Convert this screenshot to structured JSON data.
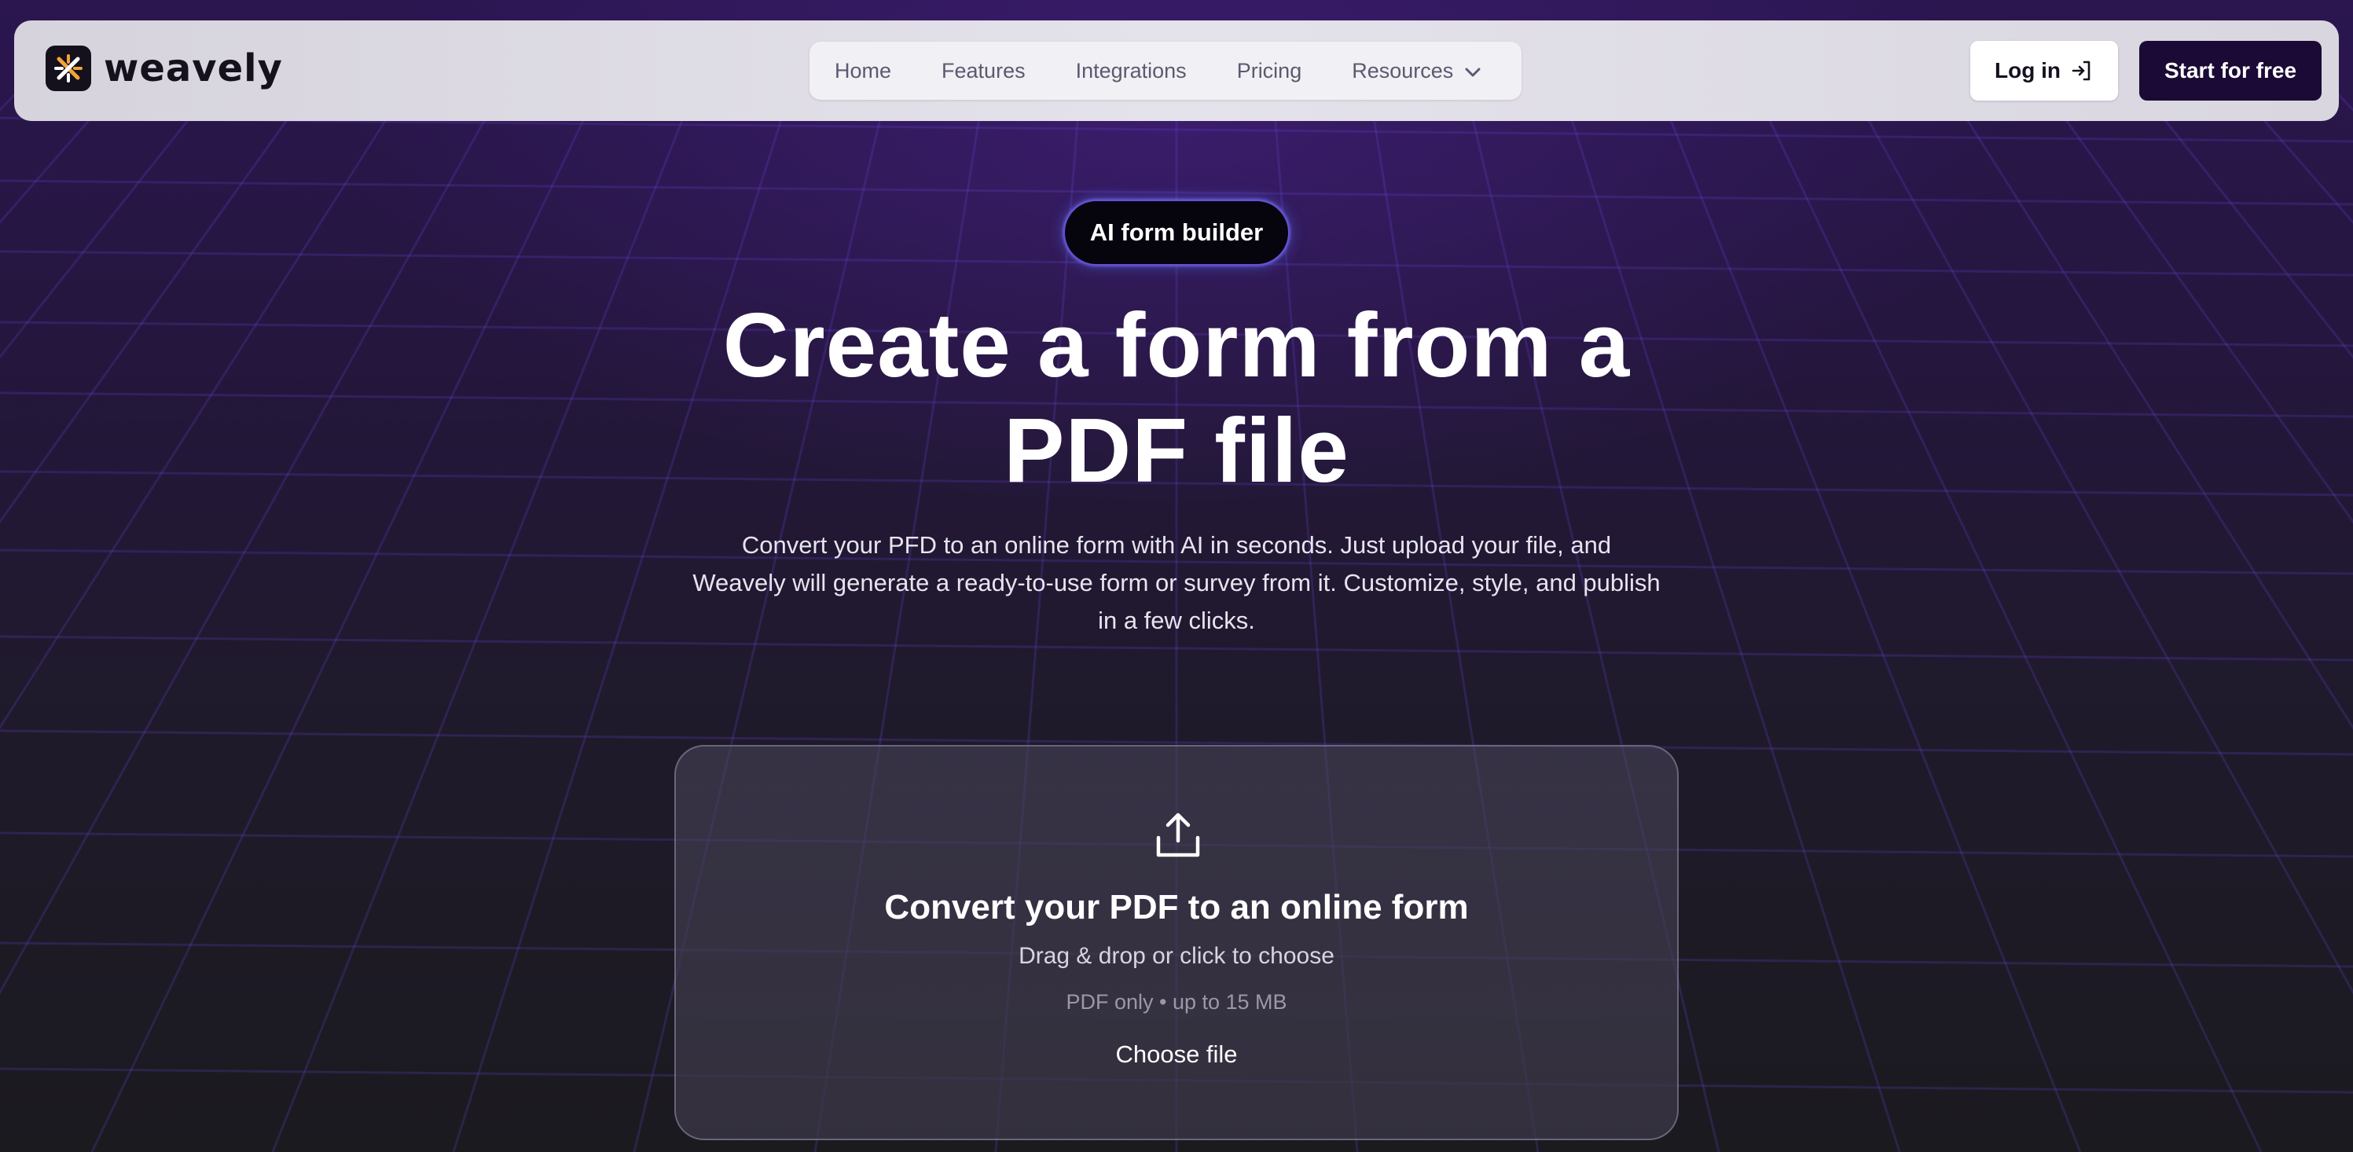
{
  "brand": {
    "name": "weavely",
    "logo_icon": "weavely-logo-icon",
    "accent_colors": [
      "#f2a33a",
      "#ffffff"
    ]
  },
  "nav": {
    "links": [
      {
        "label": "Home"
      },
      {
        "label": "Features"
      },
      {
        "label": "Integrations"
      },
      {
        "label": "Pricing"
      },
      {
        "label": "Resources",
        "icon": "chevron-down-icon"
      }
    ],
    "login_label": "Log in",
    "login_icon": "login-arrow-icon",
    "cta_label": "Start for free"
  },
  "hero": {
    "badge": "AI form builder",
    "title_line1": "Create a form from a",
    "title_line2": "PDF file",
    "subtitle_line1": "Convert your PFD to an online form with AI in seconds. Just upload your file, and",
    "subtitle_line2": "Weavely will generate a ready-to-use form or survey from it. Customize, style, and publish",
    "subtitle_line3": "in a few clicks."
  },
  "upload": {
    "icon": "upload-icon",
    "title": "Convert your PDF to an online form",
    "hint": "Drag & drop or click to choose",
    "limits": "PDF only • up to 15 MB",
    "button_label": "Choose file"
  },
  "colors": {
    "navbar_bg": "#e2e0e8",
    "cta_bg": "#1a0a35",
    "badge_glow": "#6b6cff",
    "page_bg_top": "#2b1650",
    "page_bg_bottom": "#1b1a1f"
  }
}
